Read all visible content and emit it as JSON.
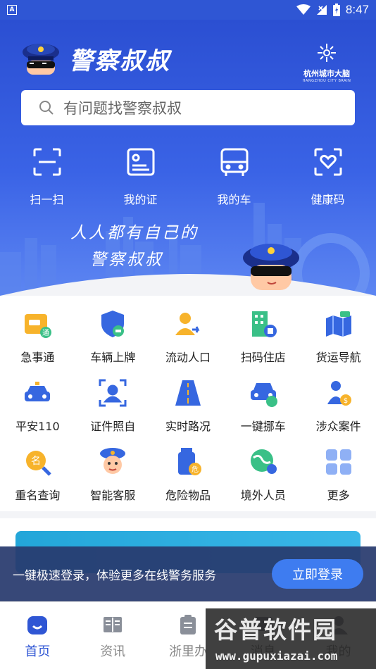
{
  "status_bar": {
    "time": "8:47",
    "left_icon": "A"
  },
  "header": {
    "app_title": "警察叔叔",
    "partner_logo_cn": "杭州城市大脑",
    "partner_logo_en": "HANGZHOU CITY BRAIN"
  },
  "search": {
    "placeholder": "有问题找警察叔叔"
  },
  "quick_actions": [
    {
      "label": "扫一扫",
      "icon": "scan-icon"
    },
    {
      "label": "我的证",
      "icon": "id-card-icon"
    },
    {
      "label": "我的车",
      "icon": "car-front-icon"
    },
    {
      "label": "健康码",
      "icon": "health-code-icon"
    }
  ],
  "slogan": {
    "line1": "人人都有自己的",
    "line2": "警察叔叔"
  },
  "services": [
    {
      "label": "急事通",
      "icon": "urgent-matters-icon"
    },
    {
      "label": "车辆上牌",
      "icon": "vehicle-plate-icon"
    },
    {
      "label": "流动人口",
      "icon": "floating-population-icon"
    },
    {
      "label": "扫码住店",
      "icon": "hotel-checkin-icon"
    },
    {
      "label": "货运导航",
      "icon": "freight-navigation-icon"
    },
    {
      "label": "平安110",
      "icon": "police-car-icon"
    },
    {
      "label": "证件照自",
      "icon": "id-photo-icon"
    },
    {
      "label": "实时路况",
      "icon": "road-status-icon"
    },
    {
      "label": "一键挪车",
      "icon": "move-car-icon"
    },
    {
      "label": "涉众案件",
      "icon": "mass-case-icon"
    },
    {
      "label": "重名查询",
      "icon": "name-search-icon"
    },
    {
      "label": "智能客服",
      "icon": "smart-service-icon"
    },
    {
      "label": "危险物品",
      "icon": "dangerous-goods-icon"
    },
    {
      "label": "境外人员",
      "icon": "foreigner-icon"
    },
    {
      "label": "更多",
      "icon": "more-grid-icon"
    }
  ],
  "login_prompt": {
    "text": "一键极速登录，体验更多在线警务服务",
    "button": "立即登录"
  },
  "tabs": [
    {
      "label": "首页",
      "icon": "home-icon",
      "active": true
    },
    {
      "label": "资讯",
      "icon": "news-icon",
      "active": false
    },
    {
      "label": "浙里办",
      "icon": "clipboard-icon",
      "active": false
    },
    {
      "label": "消息",
      "icon": "message-icon",
      "active": false
    },
    {
      "label": "我的",
      "icon": "profile-icon",
      "active": false
    }
  ],
  "watermark": {
    "top": "谷普软件园",
    "bottom": "www.gupuxiazai.com"
  },
  "colors": {
    "primary": "#2f56d4",
    "accent": "#3e7cf0"
  }
}
